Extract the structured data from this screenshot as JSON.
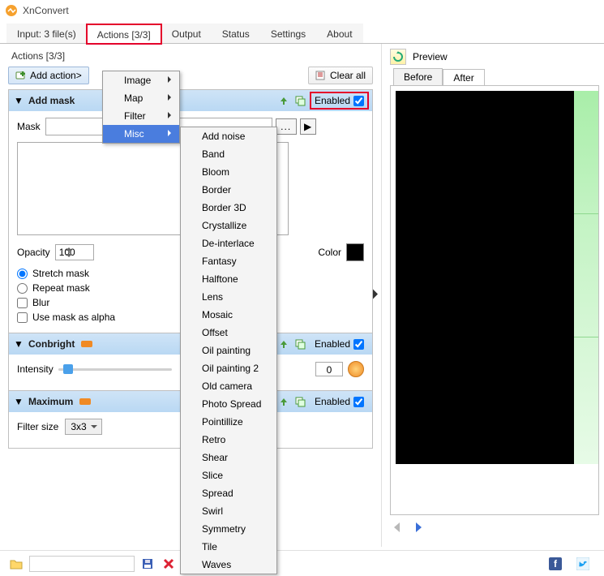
{
  "app": {
    "title": "XnConvert"
  },
  "tabs": {
    "input": "Input: 3 file(s)",
    "actions": "Actions [3/3]",
    "output": "Output",
    "status": "Status",
    "settings": "Settings",
    "about": "About"
  },
  "left": {
    "heading": "Actions [3/3]",
    "add_action": "Add action>",
    "clear_all": "Clear all",
    "enabled": "Enabled",
    "mask_action": {
      "title": "Add mask",
      "mask_label": "Mask",
      "opacity_label": "Opacity",
      "opacity_value": "100",
      "color_label": "Color",
      "stretch": "Stretch mask",
      "repeat": "Repeat mask",
      "blur": "Blur",
      "alpha": "Use mask as alpha",
      "dots": "...",
      "play": "▶"
    },
    "conbright": {
      "title": "Conbright",
      "intensity_label": "Intensity",
      "num": "0"
    },
    "maximum": {
      "title": "Maximum",
      "filter_label": "Filter size",
      "filter_value": "3x3"
    }
  },
  "menu": {
    "top": {
      "image": "Image",
      "map": "Map",
      "filter": "Filter",
      "misc": "Misc"
    },
    "misc_items": [
      "Add noise",
      "Band",
      "Bloom",
      "Border",
      "Border 3D",
      "Crystallize",
      "De-interlace",
      "Fantasy",
      "Halftone",
      "Lens",
      "Mosaic",
      "Offset",
      "Oil painting",
      "Oil painting 2",
      "Old camera",
      "Photo Spread",
      "Pointillize",
      "Retro",
      "Shear",
      "Slice",
      "Spread",
      "Swirl",
      "Symmetry",
      "Tile",
      "Waves"
    ]
  },
  "right": {
    "label": "Preview",
    "tab_before": "Before",
    "tab_after": "After"
  }
}
